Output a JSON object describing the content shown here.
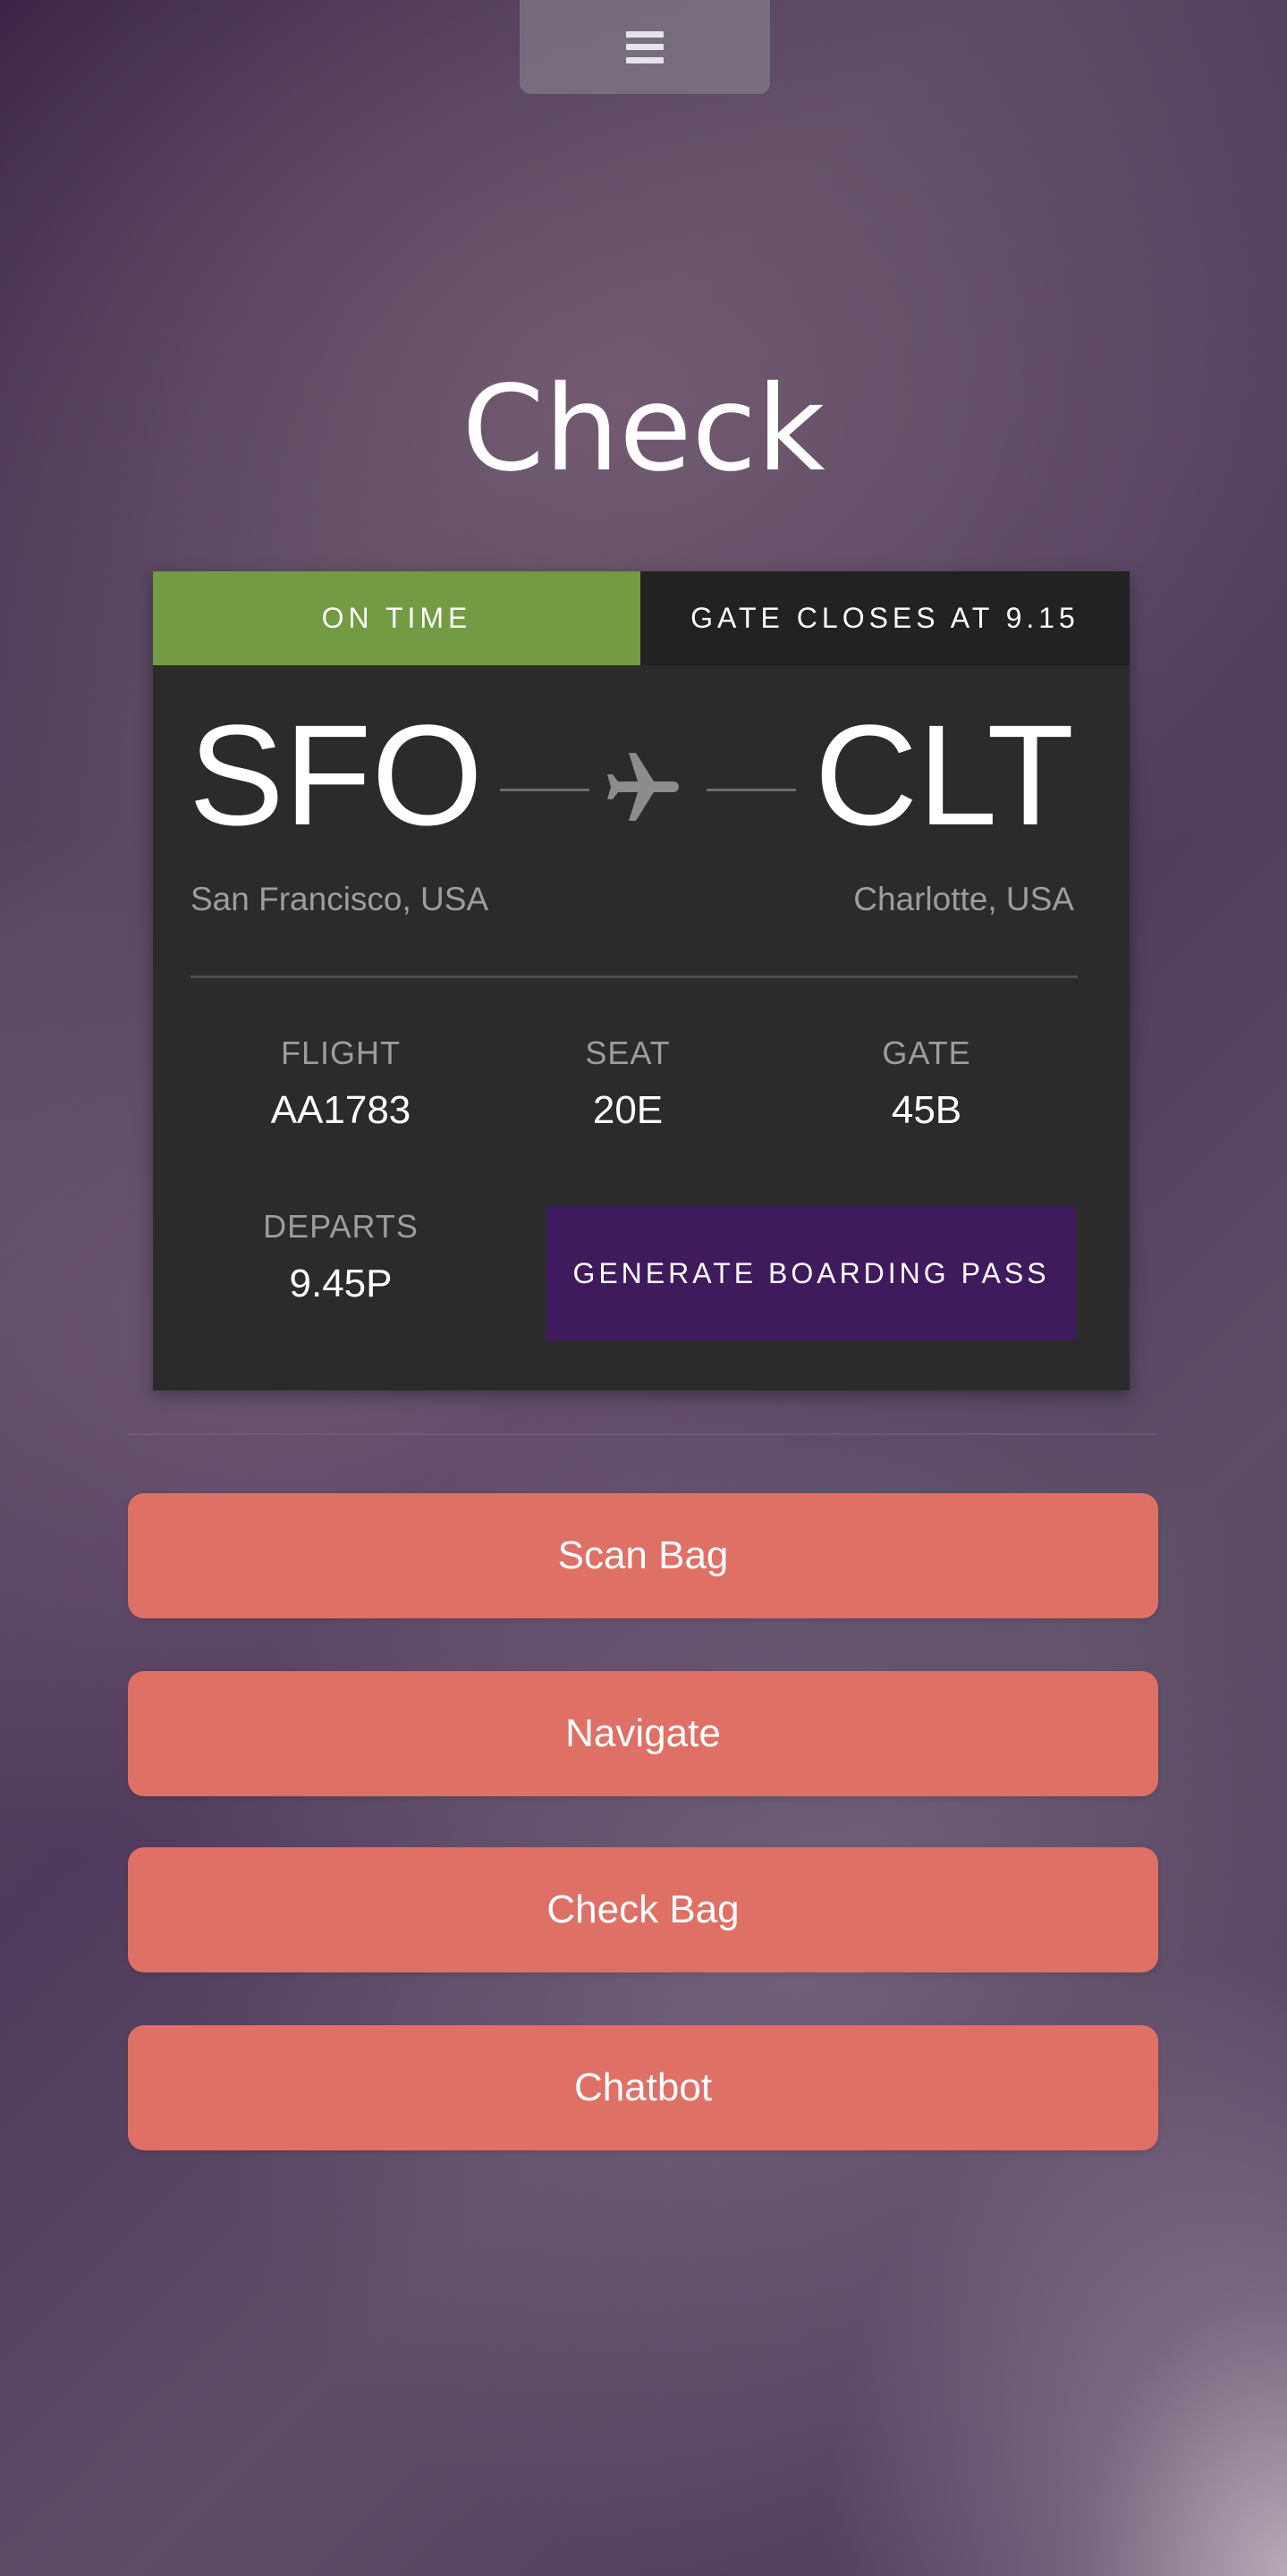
{
  "header": {
    "menu_icon": "hamburger-icon",
    "title": "Check"
  },
  "flight_card": {
    "status": "ON TIME",
    "gate_closes": "GATE CLOSES AT 9.15",
    "origin": {
      "code": "SFO",
      "city": "San Francisco, USA"
    },
    "destination": {
      "code": "CLT",
      "city": "Charlotte, USA"
    },
    "route_icon": "airplane-icon",
    "flight": {
      "label": "FLIGHT",
      "value": "AA1783"
    },
    "seat": {
      "label": "SEAT",
      "value": "20E"
    },
    "gate": {
      "label": "GATE",
      "value": "45B"
    },
    "departs": {
      "label": "DEPARTS",
      "value": "9.45P"
    },
    "boarding_pass_button": "GENERATE BOARDING PASS"
  },
  "actions": {
    "scan_bag": "Scan Bag",
    "navigate": "Navigate",
    "check_bag": "Check Bag",
    "chatbot": "Chatbot"
  },
  "colors": {
    "status_green": "#729b43",
    "boarding_purple": "#3f1b5d",
    "action_coral": "#de7066",
    "card_bg": "#2b2b2b"
  }
}
